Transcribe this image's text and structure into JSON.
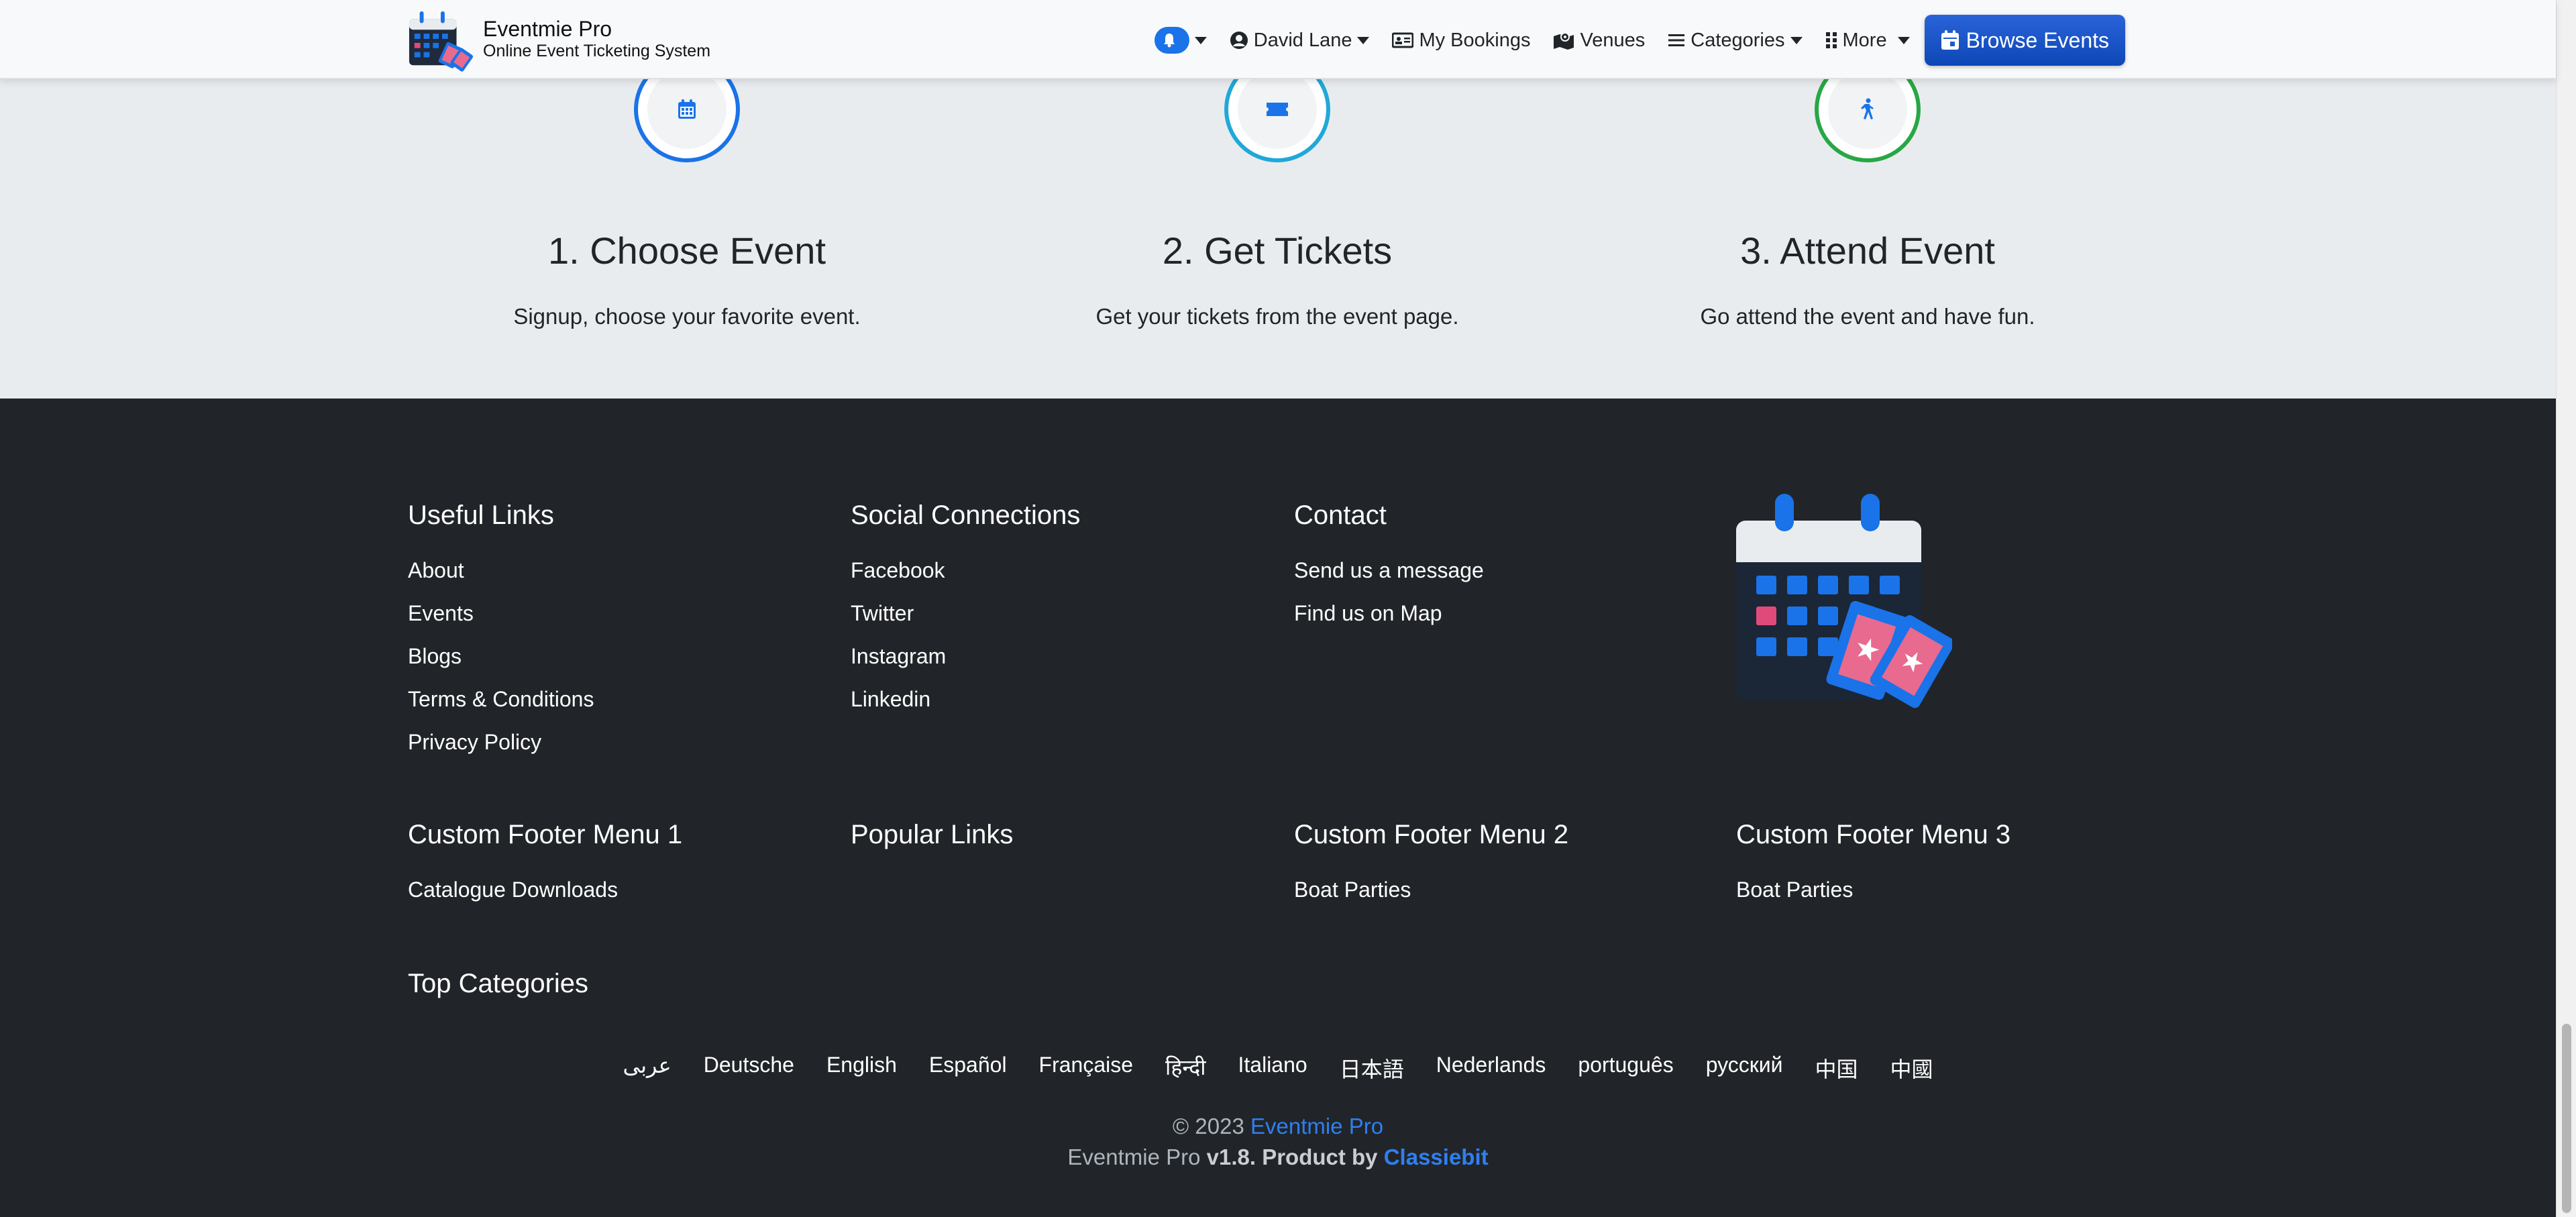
{
  "header": {
    "brand_name": "Eventmie Pro",
    "brand_tagline": "Online Event Ticketing System",
    "nav": {
      "user": "David Lane",
      "bookings": "My Bookings",
      "venues": "Venues",
      "categories": "Categories",
      "more": "More",
      "browse": "Browse Events"
    }
  },
  "steps": [
    {
      "title": "1. Choose Event",
      "desc": "Signup, choose your favorite event.",
      "icon": "calendar-icon",
      "ring_color": "#1a73e8"
    },
    {
      "title": "2. Get Tickets",
      "desc": "Get your tickets from the event page.",
      "icon": "ticket-icon",
      "ring_color": "#20a8d8"
    },
    {
      "title": "3. Attend Event",
      "desc": "Go attend the event and have fun.",
      "icon": "walking-person-icon",
      "ring_color": "#28a745"
    }
  ],
  "footer": {
    "useful_links": {
      "title": "Useful Links",
      "items": [
        "About",
        "Events",
        "Blogs",
        "Terms & Conditions",
        "Privacy Policy"
      ]
    },
    "social": {
      "title": "Social Connections",
      "items": [
        "Facebook",
        "Twitter",
        "Instagram",
        "Linkedin"
      ]
    },
    "contact": {
      "title": "Contact",
      "items": [
        "Send us a message",
        "Find us on Map"
      ]
    },
    "custom1": {
      "title": "Custom Footer Menu 1",
      "items": [
        "Catalogue Downloads"
      ]
    },
    "popular": {
      "title": "Popular Links",
      "items": []
    },
    "custom2": {
      "title": "Custom Footer Menu 2",
      "items": [
        "Boat Parties"
      ]
    },
    "custom3": {
      "title": "Custom Footer Menu 3",
      "items": [
        "Boat Parties"
      ]
    },
    "top_categories": {
      "title": "Top Categories"
    },
    "languages": [
      "عربى",
      "Deutsche",
      "English",
      "Español",
      "Française",
      "हिन्दी",
      "Italiano",
      "日本語",
      "Nederlands",
      "português",
      "русский",
      "中国",
      "中國"
    ],
    "copyright": {
      "prefix": "© 2023",
      "brand": "Eventmie Pro",
      "line2_prefix": "Eventmie Pro",
      "version": "v1.8. Product by",
      "company": "Classiebit"
    }
  },
  "colors": {
    "primary": "#1a73e8",
    "footer_bg": "#212529",
    "steps_bg": "#e9ecef"
  }
}
